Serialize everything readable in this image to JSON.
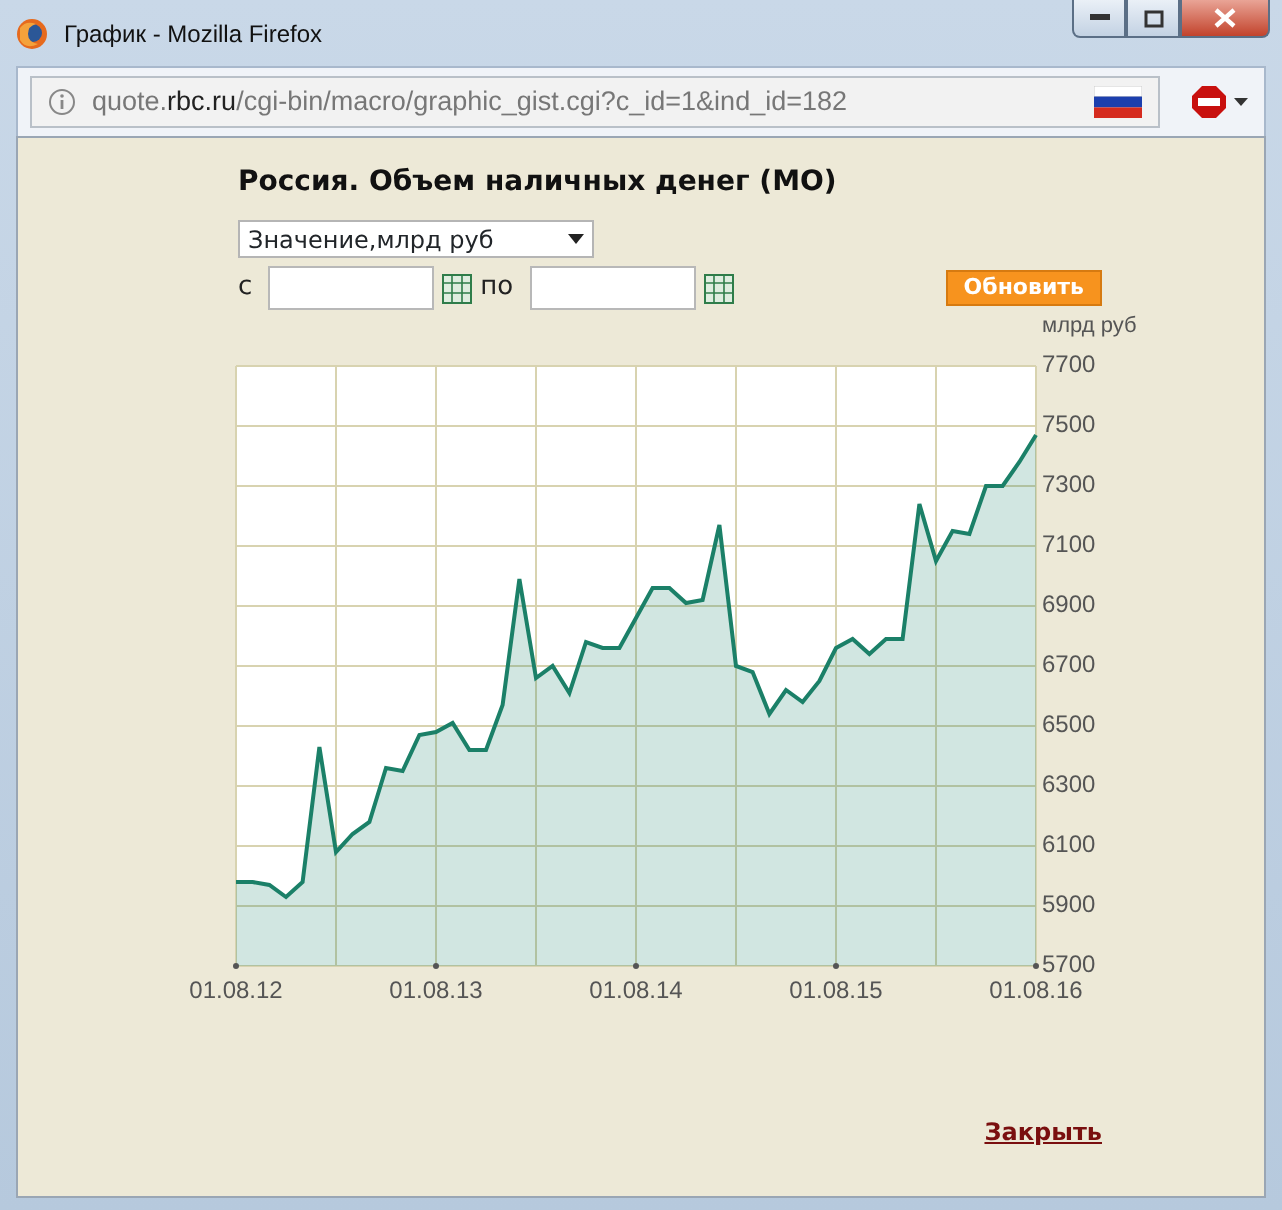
{
  "window": {
    "title": "График - Mozilla Firefox"
  },
  "address_bar": {
    "subdomain": "quote.",
    "domain": "rbc.ru",
    "path": "/cgi-bin/macro/graphic_gist.cgi?c_id=1&ind_id=182"
  },
  "page": {
    "heading": "Россия. Объем наличных денег (МО)",
    "measure_select": {
      "value": "Значение,млрд руб"
    },
    "from_label": "с",
    "to_label": "по",
    "update_button": "Обновить",
    "chart_data": {
      "type": "area",
      "ylabel": "млрд руб",
      "categories": [
        "01.08.12",
        null,
        null,
        null,
        null,
        null,
        null,
        null,
        null,
        null,
        null,
        null,
        "01.08.13",
        null,
        null,
        null,
        null,
        null,
        null,
        null,
        null,
        null,
        null,
        null,
        "01.08.14",
        null,
        null,
        null,
        null,
        null,
        null,
        null,
        null,
        null,
        null,
        null,
        "01.08.15",
        null,
        null,
        null,
        null,
        null,
        null,
        null,
        null,
        null,
        null,
        null,
        "01.08.16"
      ],
      "series": [
        {
          "color": "#1b8068",
          "values": [
            5980,
            5980,
            5970,
            5930,
            5980,
            6430,
            6080,
            6140,
            6180,
            6360,
            6350,
            6470,
            6480,
            6510,
            6420,
            6420,
            6570,
            6990,
            6660,
            6700,
            6610,
            6780,
            6760,
            6760,
            6860,
            6960,
            6960,
            6910,
            6920,
            7170,
            6700,
            6680,
            6540,
            6620,
            6580,
            6650,
            6760,
            6790,
            6740,
            6790,
            6790,
            7240,
            7050,
            7150,
            7140,
            7300,
            7300,
            7380,
            7470
          ]
        }
      ],
      "ylim": [
        5700,
        7700
      ],
      "grid": true,
      "yticks": [
        5700,
        5900,
        6100,
        6300,
        6500,
        6700,
        6900,
        7100,
        7300,
        7500,
        7700
      ]
    },
    "close_link": "Закрыть"
  }
}
